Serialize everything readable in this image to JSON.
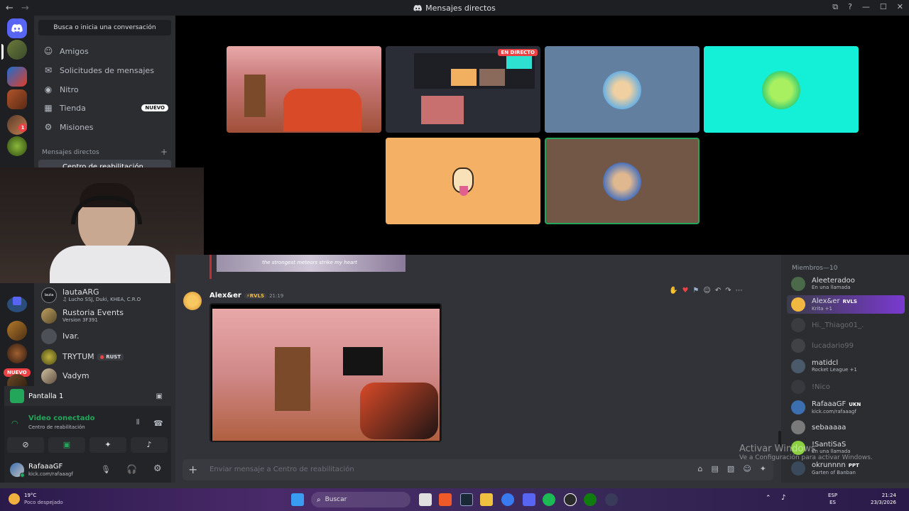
{
  "window": {
    "title": "Mensajes directos",
    "back_glyph": "←",
    "forward_glyph": "→",
    "controls": [
      "⧉",
      "?",
      "—",
      "☐",
      "✕"
    ]
  },
  "sidebar": {
    "search_label": "Busca o inicia una conversación",
    "nav": [
      {
        "label": "Amigos",
        "icon": "friends-icon"
      },
      {
        "label": "Solicitudes de mensajes",
        "icon": "envelope-icon"
      },
      {
        "label": "Nitro",
        "icon": "nitro-icon"
      },
      {
        "label": "Tienda",
        "icon": "shop-icon",
        "badge": "NUEVO"
      },
      {
        "label": "Misiones",
        "icon": "quests-icon"
      }
    ],
    "dm_header": "Mensajes directos",
    "dm_add": "+",
    "active_dm": "Centro de reabilitación",
    "dms": [
      {
        "name": "lautaARG",
        "sub": "♫ Lucho SSJ, Duki, KHEA, C.R.O"
      },
      {
        "name": "Rustoria Events",
        "sub": "Version 3F391"
      },
      {
        "name": "Ivar.",
        "sub": ""
      },
      {
        "name": "TRYTUM",
        "sub": "",
        "tag": "RUST"
      },
      {
        "name": "Vadym",
        "sub": ""
      }
    ]
  },
  "rail": {
    "new_badge": "NUEVO",
    "unread_count": "1"
  },
  "voice": {
    "screen_label": "Pantalla 1",
    "status": "Video conectado",
    "channel": "Centro de reabilitación"
  },
  "user": {
    "name": "RafaaaGF",
    "status": "kick.com/rafaaagf"
  },
  "call": {
    "live_badge": "EN DIRECTO"
  },
  "chat": {
    "embed_caption": "the strongest meteors strike my heart",
    "message": {
      "author": "Alex&er",
      "tag": "RVLS",
      "time": "21:19"
    },
    "input_placeholder": "Enviar mensaje a Centro de reabilitación"
  },
  "members": {
    "header": "Miembros—10",
    "list": [
      {
        "name": "Aleeteradoo",
        "sub": "En una llamada",
        "dim": false
      },
      {
        "name": "Alex&er",
        "sub": "Krita +1",
        "tag": "RVLS",
        "dim": false,
        "hl": true
      },
      {
        "name": "Hi._Thiago01_.",
        "sub": "",
        "dim": true
      },
      {
        "name": "lucadario99",
        "sub": "",
        "dim": true
      },
      {
        "name": "matidcl",
        "sub": "Rocket League +1",
        "dim": false
      },
      {
        "name": "!Nico",
        "sub": "",
        "dim": true
      },
      {
        "name": "RafaaaGF",
        "sub": "kick.com/rafaaagf",
        "tag": "UKN",
        "dim": false
      },
      {
        "name": "sebaaaaa",
        "sub": "",
        "dim": false
      },
      {
        "name": "!SantiSaS",
        "sub": "En una llamada",
        "dim": false
      },
      {
        "name": "okrunnnn",
        "sub": "Garten of Banban",
        "tag": "PPT",
        "dim": false
      }
    ]
  },
  "watermark": {
    "line1": "Activar Windows",
    "line2": "Ve a Configuración para activar Windows."
  },
  "taskbar": {
    "weather_temp": "19°C",
    "weather_desc": "Poco despejado",
    "search_placeholder": "Buscar",
    "lang1": "ESP",
    "lang2": "ES",
    "time": "21:24",
    "date": "23/3/2026"
  },
  "colors": {
    "discord_blurple": "#5865f2",
    "online_green": "#23a55a",
    "live_red": "#ed4245"
  }
}
